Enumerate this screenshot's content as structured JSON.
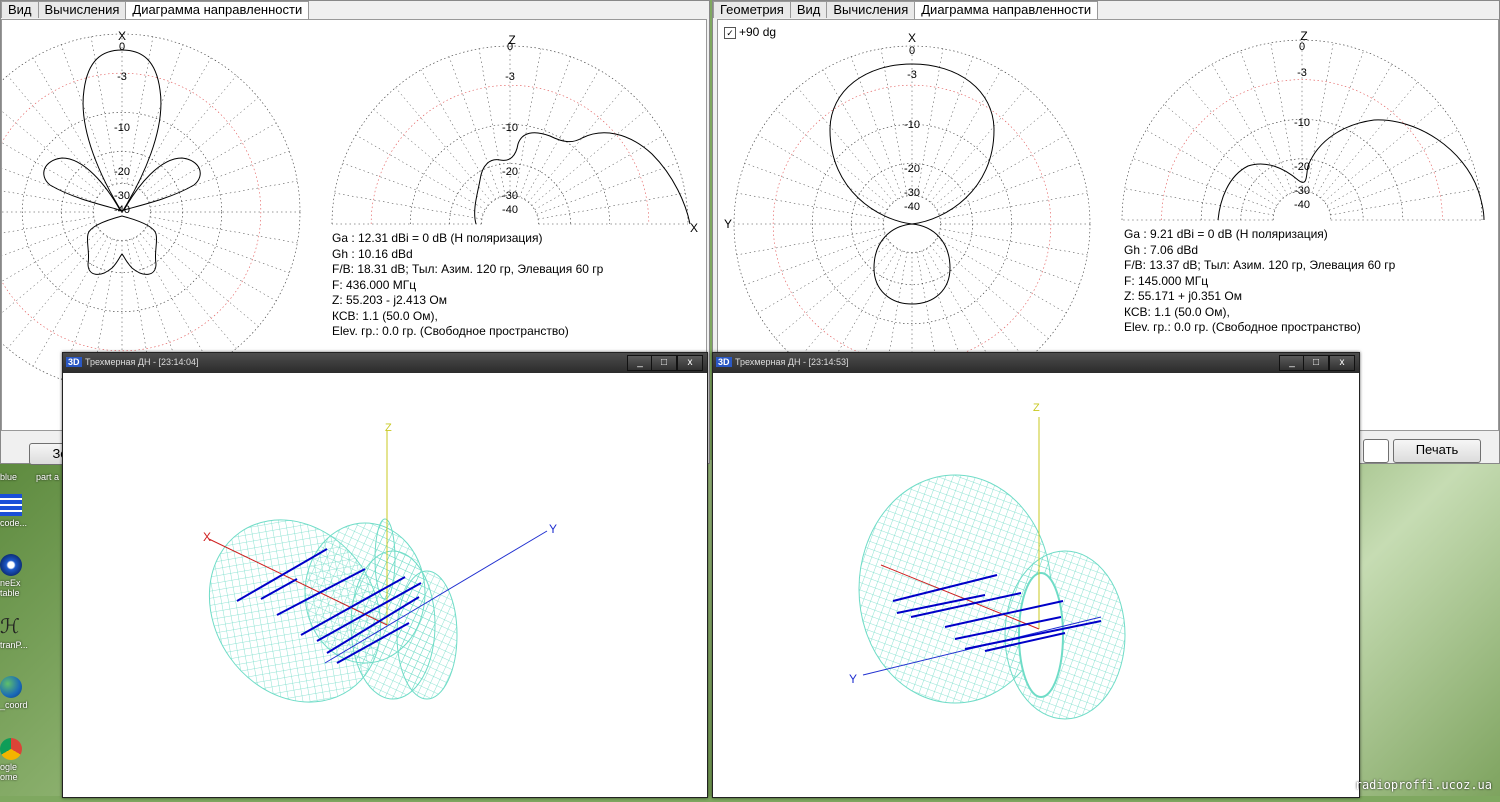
{
  "left_window": {
    "tabs": [
      "Вид",
      "Вычисления",
      "Диаграмма направленности"
    ],
    "active_tab": "Диаграмма направленности",
    "button_label": "Зе",
    "azimuth_plot": {
      "axis_label": "X",
      "ring_labels": [
        "0",
        "-3",
        "-10",
        "-20",
        "-30",
        "-40"
      ]
    },
    "elevation_plot": {
      "top_label": "Z",
      "side_label": "X",
      "ring_labels": [
        "0",
        "-3",
        "-10",
        "-20",
        "-30",
        "-40"
      ]
    },
    "info_lines": [
      "Ga : 12.31 dBi = 0 dB  (H поляризация)",
      "Gh : 10.16 dBd",
      "F/B: 18.31 dB; Тыл: Азим. 120 гр, Элевация 60 гр",
      "F: 436.000 МГц",
      "Z: 55.203 - j2.413 Ом",
      "КСВ: 1.1 (50.0 Ом),",
      "Elev. гр.: 0.0 гр. (Свободное пространство)"
    ]
  },
  "right_window": {
    "tabs": [
      "Геометрия",
      "Вид",
      "Вычисления",
      "Диаграмма направленности"
    ],
    "active_tab": "Диаграмма направленности",
    "checkbox_label": "+90 dg",
    "checkbox_checked": true,
    "print_button": "Печать",
    "azimuth_plot": {
      "top_label": "X",
      "side_label": "Y",
      "ring_labels": [
        "0",
        "-3",
        "-10",
        "-20",
        "-30",
        "-40"
      ]
    },
    "elevation_plot": {
      "top_label": "Z",
      "side_label": "X",
      "ring_labels": [
        "0",
        "-3",
        "-10",
        "-20",
        "-30",
        "-40"
      ]
    },
    "info_lines": [
      "Ga : 9.21 dBi = 0 dB  (H поляризация)",
      "Gh : 7.06 dBd",
      "F/B: 13.37 dB; Тыл: Азим. 120 гр, Элевация 60 гр",
      "F: 145.000 МГц",
      "Z: 55.171 + j0.351 Ом",
      "КСВ: 1.1 (50.0 Ом),",
      "Elev. гр.: 0.0 гр. (Свободное пространство)"
    ]
  },
  "win3d_left": {
    "badge": "3D",
    "title": "Трехмерная ДН - [23:14:04]",
    "controls": [
      "_",
      "□",
      "x"
    ],
    "axes": {
      "x": "X",
      "y": "Y",
      "z": "Z"
    }
  },
  "win3d_right": {
    "badge": "3D",
    "title": "Трехмерная ДН - [23:14:53]",
    "controls": [
      "_",
      "□",
      "x"
    ],
    "axes": {
      "y": "Y",
      "z": "Z"
    }
  },
  "desktop": {
    "icons": [
      {
        "label": "blue",
        "icon": "blue-icon"
      },
      {
        "label": "part a",
        "icon": "part-icon"
      },
      {
        "label": "code...",
        "icon": "grid-icon"
      },
      {
        "label": "neEx table",
        "icon": "blue-circle-icon"
      },
      {
        "label": "tranP...",
        "icon": "script-icon"
      },
      {
        "label": "_coord",
        "icon": "globe-icon"
      },
      {
        "label": "ogle ome",
        "icon": "chrome-icon"
      }
    ],
    "watermark": "radioproffi.ucoz.ua"
  },
  "colors": {
    "wire_pattern": "#6fdcc7",
    "dipole": "#0000c8",
    "axis_y": "#2030d0",
    "axis_x": "#d02020",
    "axis_z": "#c8c820",
    "grid_red": "#e05050",
    "grid_black": "#333333"
  }
}
